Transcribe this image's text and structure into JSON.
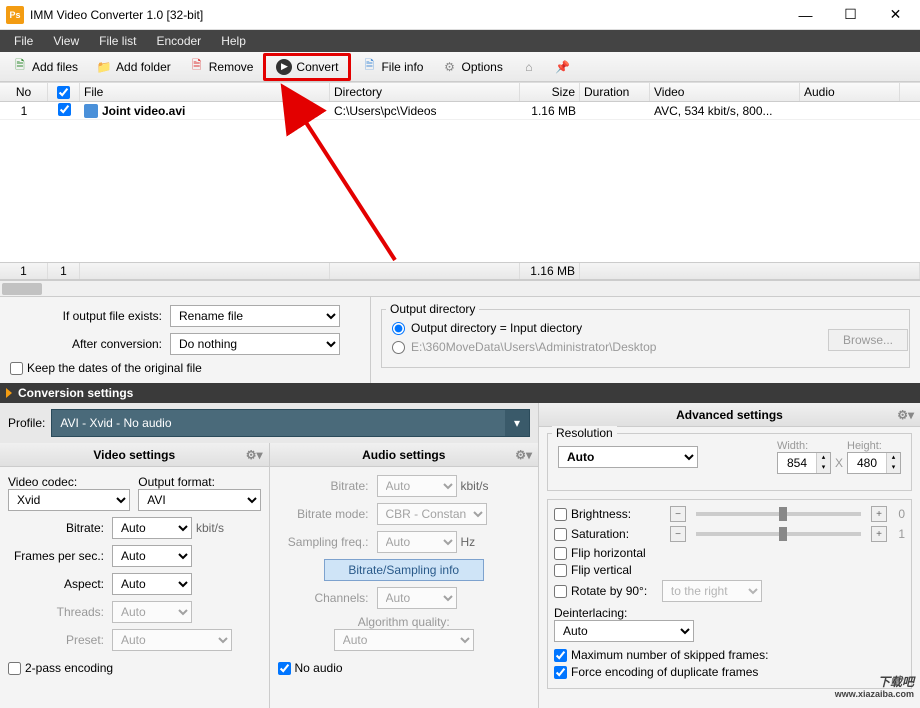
{
  "title": "IMM Video Converter 1.0  [32-bit]",
  "menu": {
    "file": "File",
    "view": "View",
    "filelist": "File list",
    "encoder": "Encoder",
    "help": "Help"
  },
  "toolbar": {
    "addfiles": "Add files",
    "addfolder": "Add folder",
    "remove": "Remove",
    "convert": "Convert",
    "fileinfo": "File info",
    "options": "Options"
  },
  "columns": {
    "no": "No",
    "file": "File",
    "directory": "Directory",
    "size": "Size",
    "duration": "Duration",
    "video": "Video",
    "audio": "Audio"
  },
  "rows": [
    {
      "no": "1",
      "checked": true,
      "file": "Joint video.avi",
      "directory": "C:\\Users\\pc\\Videos",
      "size": "1.16 MB",
      "duration": "",
      "video": "AVC, 534 kbit/s, 800...",
      "audio": ""
    }
  ],
  "footer": {
    "count1": "1",
    "count2": "1",
    "totalSize": "1.16 MB"
  },
  "midleft": {
    "ifexists_label": "If output file exists:",
    "ifexists_value": "Rename file",
    "afterconv_label": "After conversion:",
    "afterconv_value": "Do nothing",
    "keepdates": "Keep the dates of the original file"
  },
  "midright": {
    "legend": "Output directory",
    "opt1": "Output directory = Input diectory",
    "opt2": "E:\\360MoveData\\Users\\Administrator\\Desktop",
    "browse": "Browse..."
  },
  "conv_header": "Conversion settings",
  "profile_label": "Profile:",
  "profile_value": "AVI - Xvid - No audio",
  "video_settings": {
    "title": "Video settings",
    "codec_label": "Video codec:",
    "codec_value": "Xvid",
    "outfmt_label": "Output format:",
    "outfmt_value": "AVI",
    "bitrate_label": "Bitrate:",
    "bitrate_value": "Auto",
    "bitrate_unit": "kbit/s",
    "fps_label": "Frames per sec.:",
    "fps_value": "Auto",
    "aspect_label": "Aspect:",
    "aspect_value": "Auto",
    "threads_label": "Threads:",
    "threads_value": "Auto",
    "preset_label": "Preset:",
    "preset_value": "Auto",
    "twopass": "2-pass encoding"
  },
  "audio_settings": {
    "title": "Audio settings",
    "bitrate_label": "Bitrate:",
    "bitrate_value": "Auto",
    "bitrate_unit": "kbit/s",
    "mode_label": "Bitrate mode:",
    "mode_value": "CBR - Constant",
    "freq_label": "Sampling freq.:",
    "freq_value": "Auto",
    "freq_unit": "Hz",
    "info_btn": "Bitrate/Sampling info",
    "channels_label": "Channels:",
    "channels_value": "Auto",
    "algo_label": "Algorithm quality:",
    "algo_value": "Auto",
    "noaudio": "No audio"
  },
  "advanced": {
    "title": "Advanced settings",
    "res_legend": "Resolution",
    "res_value": "Auto",
    "width_label": "Width:",
    "width_value": "854",
    "height_label": "Height:",
    "height_value": "480",
    "x": "X",
    "brightness": "Brightness:",
    "brightness_val": "0",
    "saturation": "Saturation:",
    "saturation_val": "1",
    "fliph": "Flip horizontal",
    "flipv": "Flip vertical",
    "rotate": "Rotate by 90°:",
    "rotate_value": "to the right",
    "deint_label": "Deinterlacing:",
    "deint_value": "Auto",
    "maxskip": "Maximum number of skipped frames:",
    "forcedup": "Force encoding of duplicate frames"
  },
  "watermark": {
    "main": "下载吧",
    "sub": "www.xiazaiba.com"
  }
}
